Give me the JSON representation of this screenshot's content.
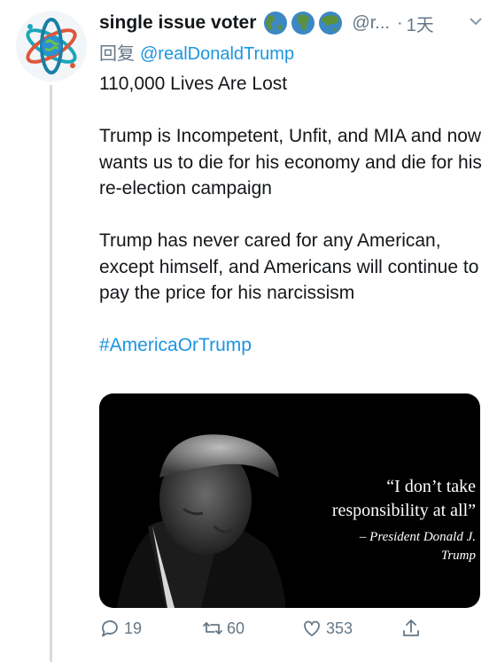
{
  "tweet": {
    "display_name": "single issue voter",
    "name_emojis": [
      "globe-americas-icon",
      "globe-africa-icon",
      "globe-asia-icon"
    ],
    "handle": "@r...",
    "separator": "·",
    "time": "1天",
    "reply_prefix": "回复",
    "reply_to": "@realDonaldTrump",
    "paragraphs": [
      "110,000 Lives Are Lost",
      "Trump is Incompetent, Unfit, and MIA and now wants us to die for his economy and die for his re-election campaign",
      "Trump has never cared for any American, except himself, and Americans will continue to pay the price for his narcissism"
    ],
    "hashtag": "#AmericaOrTrump",
    "media": {
      "quote_line1": "“I don’t take",
      "quote_line2": "responsibility at all”",
      "attrib_line1": "– President Donald J.",
      "attrib_line2": "Trump"
    },
    "actions": {
      "reply_count": "19",
      "retweet_count": "60",
      "like_count": "353"
    }
  },
  "colors": {
    "link": "#1b95e0",
    "secondary_text": "#657786",
    "thread_line": "#d6dbdf"
  }
}
